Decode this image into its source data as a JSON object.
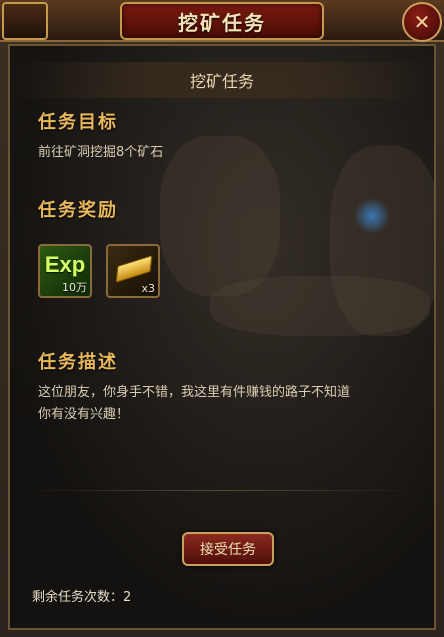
{
  "window": {
    "title": "挖矿任务",
    "close_label": "✕"
  },
  "quest": {
    "name": "挖矿任务",
    "objective_heading": "任务目标",
    "objective_text": "前往矿洞挖掘8个矿石",
    "reward_heading": "任务奖励",
    "rewards": [
      {
        "name": "exp",
        "icon": "Exp",
        "count": "10万"
      },
      {
        "name": "gold-bar",
        "icon": "gold-bar-icon",
        "count": "x3"
      }
    ],
    "description_heading": "任务描述",
    "description_line1": "这位朋友，你身手不错，我这里有件赚钱的路子不知道",
    "description_line2": "你有没有兴趣！"
  },
  "actions": {
    "accept_label": "接受任务"
  },
  "status": {
    "remaining_label": "剩余任务次数：2"
  },
  "colors": {
    "accent_gold": "#e9b85c",
    "button_red": "#8b2a1e"
  }
}
